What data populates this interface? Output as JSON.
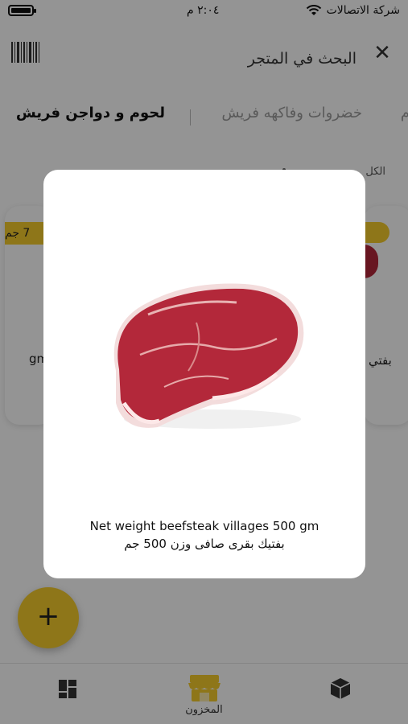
{
  "status_bar": {
    "time": "٢:٠٤ م",
    "carrier": "شركة الاتصالات"
  },
  "header": {
    "title": "البحث في المتجر",
    "close_icon": "close-icon",
    "barcode_icon": "barcode-icon"
  },
  "tabs": [
    {
      "label": "لحوم و دواجن فريش",
      "active": true
    },
    {
      "label": "خضروات وفاكهه فريش",
      "active": false
    },
    {
      "label": "م",
      "active": false
    }
  ],
  "filter": {
    "label": "الكل"
  },
  "cards": {
    "left": {
      "price": "7 جم",
      "text": "gm"
    },
    "right": {
      "text": "بفتي"
    }
  },
  "fab": {
    "label": "+"
  },
  "bottom_nav": {
    "items": [
      {
        "icon": "dashboard-icon",
        "label": ""
      },
      {
        "icon": "store-icon",
        "label": "المخزون"
      },
      {
        "icon": "box-icon",
        "label": ""
      }
    ]
  },
  "modal": {
    "image": "beef-steak-image",
    "caption_en": "Net weight beefsteak villages 500 gm",
    "caption_ar": "بفتيك بقرى صافى وزن 500 جم"
  },
  "colors": {
    "accent": "#f5cc2b",
    "overlay": "rgba(0,0,0,0.42)"
  }
}
